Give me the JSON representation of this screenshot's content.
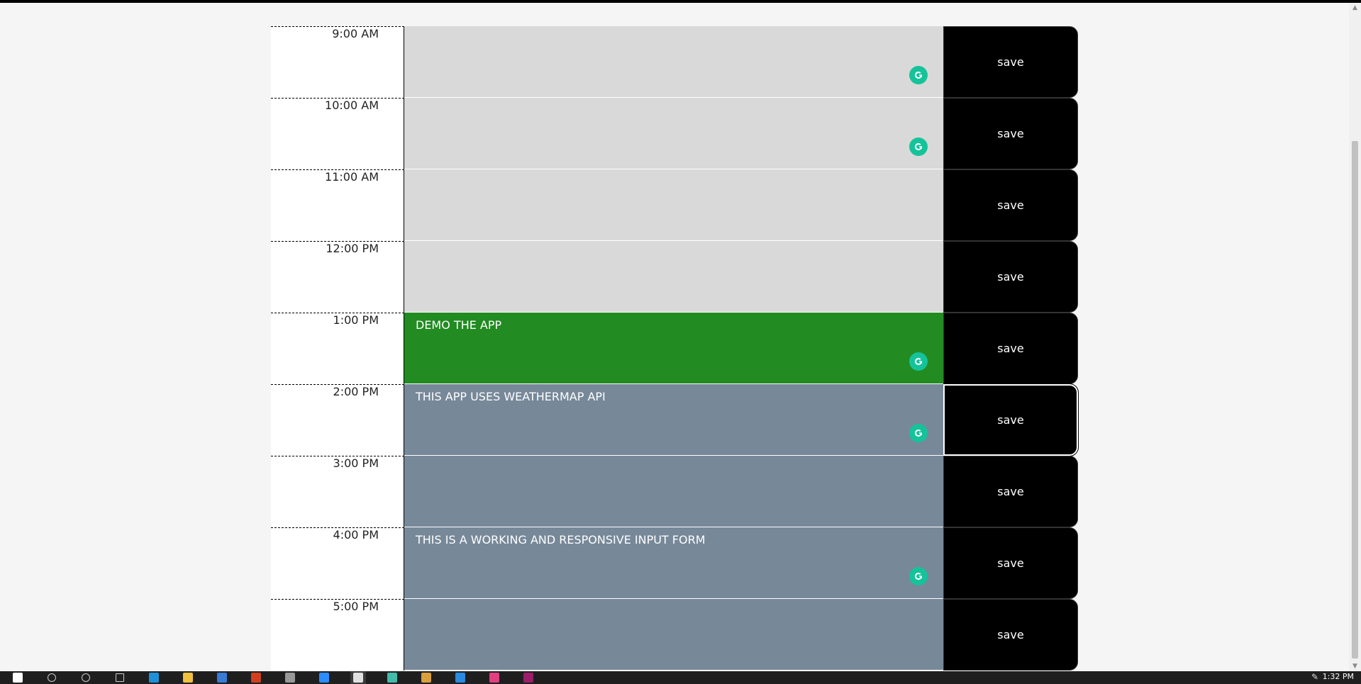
{
  "rows": [
    {
      "time": "9:00 AM",
      "text": "",
      "state": "past",
      "grammarly": true,
      "save_label": "save"
    },
    {
      "time": "10:00 AM",
      "text": "",
      "state": "past",
      "grammarly": true,
      "save_label": "save"
    },
    {
      "time": "11:00 AM",
      "text": "",
      "state": "past",
      "grammarly": false,
      "save_label": "save"
    },
    {
      "time": "12:00 PM",
      "text": "",
      "state": "past",
      "grammarly": false,
      "save_label": "save"
    },
    {
      "time": "1:00 PM",
      "text": "DEMO THE APP",
      "state": "present",
      "grammarly": true,
      "save_label": "save"
    },
    {
      "time": "2:00 PM",
      "text": "THIS APP USES WEATHERMAP API",
      "state": "future",
      "grammarly": true,
      "save_label": "save"
    },
    {
      "time": "3:00 PM",
      "text": "",
      "state": "future",
      "grammarly": false,
      "save_label": "save"
    },
    {
      "time": "4:00 PM",
      "text": "THIS IS A WORKING AND RESPONSIVE INPUT FORM",
      "state": "future",
      "grammarly": true,
      "save_label": "save"
    },
    {
      "time": "5:00 PM",
      "text": "",
      "state": "future",
      "grammarly": false,
      "save_label": "save"
    }
  ],
  "taskbar": {
    "clock": "1:32 PM",
    "icons": [
      "windows-start-icon",
      "search-icon",
      "cortana-icon",
      "task-view-icon",
      "edge-icon",
      "file-explorer-icon",
      "mail-icon",
      "office-icon",
      "store-icon",
      "zoom-icon",
      "chrome-icon",
      "network-app-icon",
      "paint-icon",
      "vscode-icon",
      "instagram-icon",
      "adobe-xd-icon"
    ]
  },
  "colors": {
    "past": "#d9d9d9",
    "present": "#228b22",
    "future": "#778899",
    "save_bg": "#000000",
    "grammarly": "#15c39a"
  }
}
